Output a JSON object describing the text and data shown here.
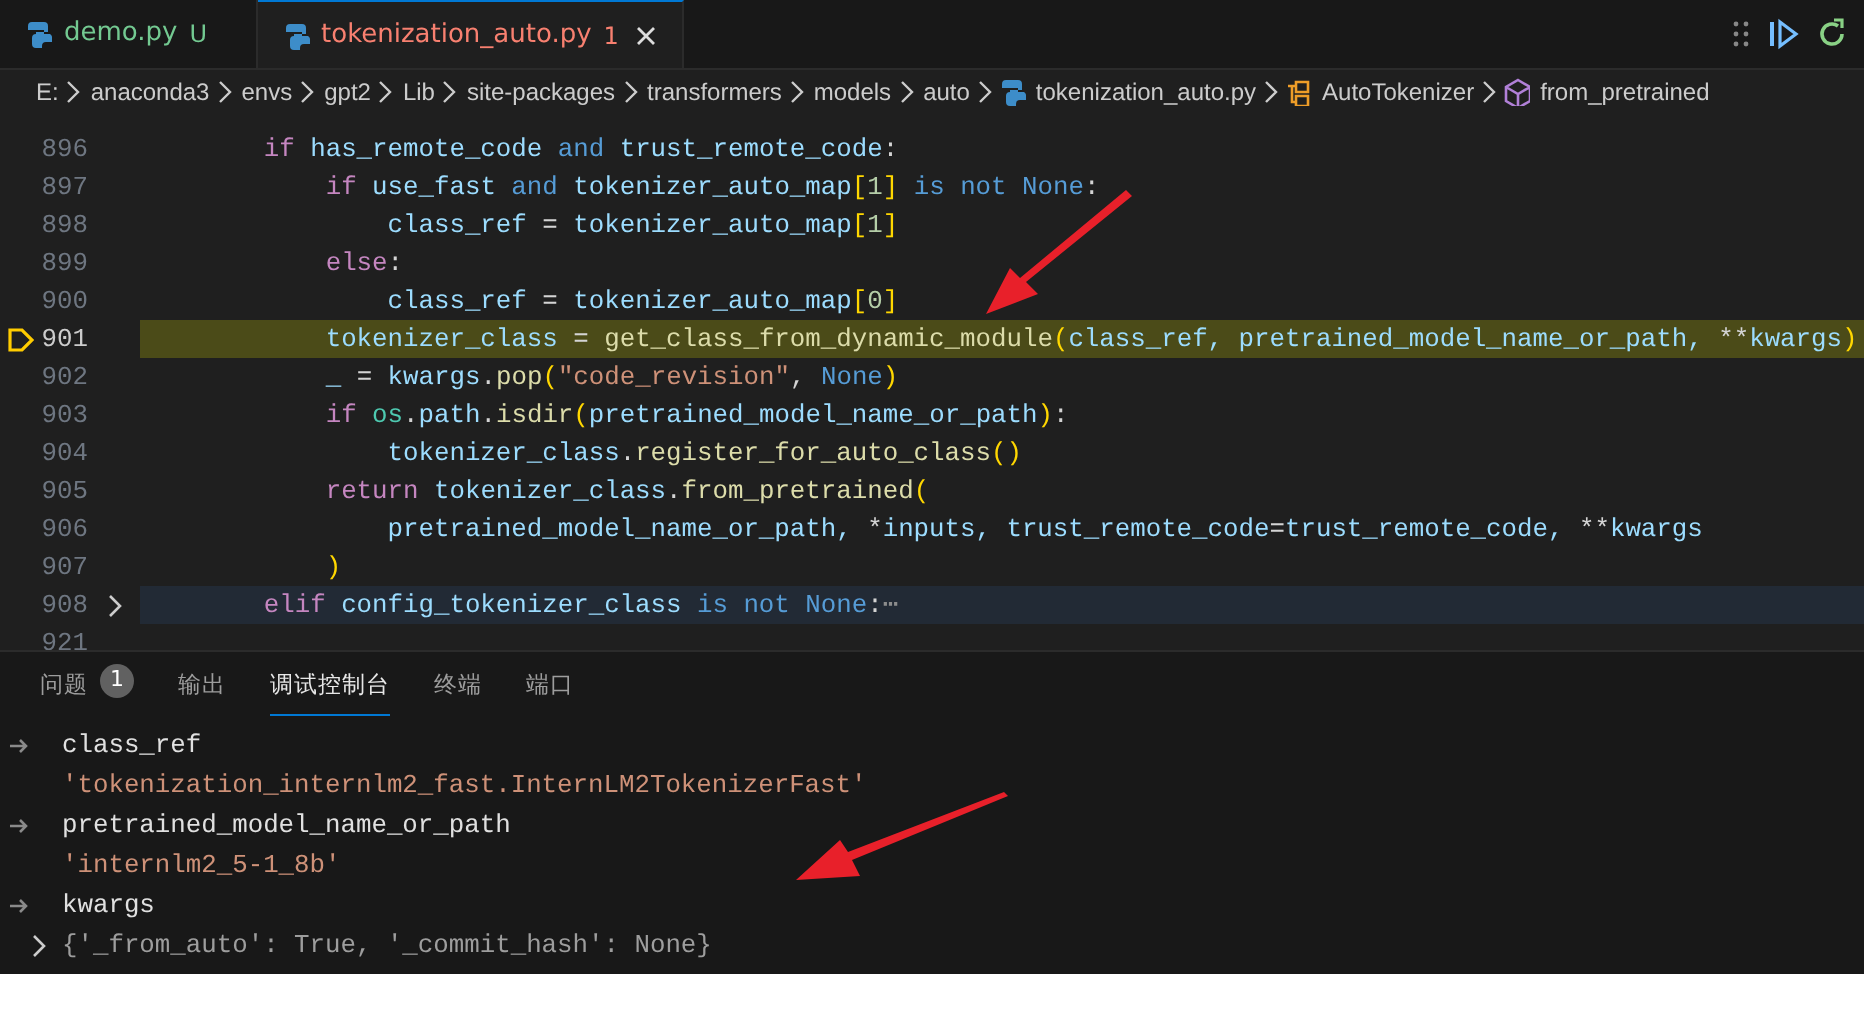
{
  "tabs": [
    {
      "label": "demo.py",
      "badge": "U",
      "color": "#73c991",
      "selected": false
    },
    {
      "label": "tokenization_auto.py",
      "badge": "1",
      "color": "#f88070",
      "selected": true
    }
  ],
  "breadcrumbs": [
    {
      "label": "E:",
      "kind": "folder"
    },
    {
      "label": "anaconda3",
      "kind": "folder"
    },
    {
      "label": "envs",
      "kind": "folder"
    },
    {
      "label": "gpt2",
      "kind": "folder"
    },
    {
      "label": "Lib",
      "kind": "folder"
    },
    {
      "label": "site-packages",
      "kind": "folder"
    },
    {
      "label": "transformers",
      "kind": "folder"
    },
    {
      "label": "models",
      "kind": "folder"
    },
    {
      "label": "auto",
      "kind": "folder"
    },
    {
      "label": "tokenization_auto.py",
      "kind": "file"
    },
    {
      "label": "AutoTokenizer",
      "kind": "class"
    },
    {
      "label": "from_pretrained",
      "kind": "method"
    }
  ],
  "code_lines": [
    {
      "number": "896",
      "current": false,
      "folded": false,
      "tokens": [
        {
          "t": "        if",
          "kind": "control"
        },
        {
          "t": " has_remote_code ",
          "kind": "var"
        },
        {
          "t": "and",
          "kind": "keyword"
        },
        {
          "t": " trust_remote_code",
          "kind": "var"
        },
        {
          "t": ":",
          "kind": "plain"
        }
      ]
    },
    {
      "number": "897",
      "current": false,
      "folded": false,
      "tokens": [
        {
          "t": "            if",
          "kind": "control"
        },
        {
          "t": " use_fast ",
          "kind": "var"
        },
        {
          "t": "and",
          "kind": "keyword"
        },
        {
          "t": " tokenizer_auto_map",
          "kind": "var"
        },
        {
          "t": "[",
          "kind": "bracket"
        },
        {
          "t": "1",
          "kind": "number"
        },
        {
          "t": "]",
          "kind": "bracket"
        },
        {
          "t": " is not None",
          "kind": "keyword"
        },
        {
          "t": ":",
          "kind": "plain"
        }
      ]
    },
    {
      "number": "898",
      "current": false,
      "folded": false,
      "tokens": [
        {
          "t": "                class_ref",
          "kind": "var"
        },
        {
          "t": " = ",
          "kind": "plain"
        },
        {
          "t": "tokenizer_auto_map",
          "kind": "var"
        },
        {
          "t": "[",
          "kind": "bracket"
        },
        {
          "t": "1",
          "kind": "number"
        },
        {
          "t": "]",
          "kind": "bracket"
        }
      ]
    },
    {
      "number": "899",
      "current": false,
      "folded": false,
      "tokens": [
        {
          "t": "            else",
          "kind": "control"
        },
        {
          "t": ":",
          "kind": "plain"
        }
      ]
    },
    {
      "number": "900",
      "current": false,
      "folded": false,
      "tokens": [
        {
          "t": "                class_ref",
          "kind": "var"
        },
        {
          "t": " = ",
          "kind": "plain"
        },
        {
          "t": "tokenizer_auto_map",
          "kind": "var"
        },
        {
          "t": "[",
          "kind": "bracket"
        },
        {
          "t": "0",
          "kind": "number"
        },
        {
          "t": "]",
          "kind": "bracket"
        }
      ]
    },
    {
      "number": "901",
      "current": true,
      "folded": false,
      "tokens": [
        {
          "t": "            tokenizer_class",
          "kind": "var"
        },
        {
          "t": " = ",
          "kind": "plain"
        },
        {
          "t": "get_class_from_dynamic_module",
          "kind": "function"
        },
        {
          "t": "(",
          "kind": "bracket"
        },
        {
          "t": "class_ref, pretrained_model_name_or_path, ",
          "kind": "var"
        },
        {
          "t": "**",
          "kind": "plain"
        },
        {
          "t": "kwargs",
          "kind": "var"
        },
        {
          "t": ")",
          "kind": "bracket"
        }
      ]
    },
    {
      "number": "902",
      "current": false,
      "folded": false,
      "tokens": [
        {
          "t": "            _",
          "kind": "var"
        },
        {
          "t": " = ",
          "kind": "plain"
        },
        {
          "t": "kwargs",
          "kind": "var"
        },
        {
          "t": ".",
          "kind": "plain"
        },
        {
          "t": "pop",
          "kind": "function"
        },
        {
          "t": "(",
          "kind": "bracket"
        },
        {
          "t": "\"code_revision\"",
          "kind": "string"
        },
        {
          "t": ", ",
          "kind": "plain"
        },
        {
          "t": "None",
          "kind": "keyword"
        },
        {
          "t": ")",
          "kind": "bracket"
        }
      ]
    },
    {
      "number": "903",
      "current": false,
      "folded": false,
      "tokens": [
        {
          "t": "            if",
          "kind": "control"
        },
        {
          "t": " os",
          "kind": "module"
        },
        {
          "t": ".",
          "kind": "plain"
        },
        {
          "t": "path",
          "kind": "var"
        },
        {
          "t": ".",
          "kind": "plain"
        },
        {
          "t": "isdir",
          "kind": "function"
        },
        {
          "t": "(",
          "kind": "bracket"
        },
        {
          "t": "pretrained_model_name_or_path",
          "kind": "var"
        },
        {
          "t": ")",
          "kind": "bracket"
        },
        {
          "t": ":",
          "kind": "plain"
        }
      ]
    },
    {
      "number": "904",
      "current": false,
      "folded": false,
      "tokens": [
        {
          "t": "                tokenizer_class",
          "kind": "var"
        },
        {
          "t": ".",
          "kind": "plain"
        },
        {
          "t": "register_for_auto_class",
          "kind": "function"
        },
        {
          "t": "()",
          "kind": "bracket"
        }
      ]
    },
    {
      "number": "905",
      "current": false,
      "folded": false,
      "tokens": [
        {
          "t": "            return",
          "kind": "control"
        },
        {
          "t": " tokenizer_class",
          "kind": "var"
        },
        {
          "t": ".",
          "kind": "plain"
        },
        {
          "t": "from_pretrained",
          "kind": "function"
        },
        {
          "t": "(",
          "kind": "bracket"
        }
      ]
    },
    {
      "number": "906",
      "current": false,
      "folded": false,
      "tokens": [
        {
          "t": "                pretrained_model_name_or_path, ",
          "kind": "var"
        },
        {
          "t": "*",
          "kind": "plain"
        },
        {
          "t": "inputs, trust_remote_code",
          "kind": "var"
        },
        {
          "t": "=",
          "kind": "plain"
        },
        {
          "t": "trust_remote_code, ",
          "kind": "var"
        },
        {
          "t": "**",
          "kind": "plain"
        },
        {
          "t": "kwargs",
          "kind": "var"
        }
      ]
    },
    {
      "number": "907",
      "current": false,
      "folded": false,
      "tokens": [
        {
          "t": "            )",
          "kind": "bracket"
        }
      ]
    },
    {
      "number": "908",
      "current": false,
      "folded": true,
      "tokens": [
        {
          "t": "        elif",
          "kind": "control"
        },
        {
          "t": " config_tokenizer_class ",
          "kind": "var"
        },
        {
          "t": "is not None",
          "kind": "keyword"
        },
        {
          "t": ":",
          "kind": "plain"
        },
        {
          "t": "⋯",
          "kind": "ellipsis"
        }
      ]
    },
    {
      "number": "921",
      "current": false,
      "folded": false
    }
  ],
  "panel_tabs": [
    {
      "label": "问题",
      "badge": "1",
      "selected": false
    },
    {
      "label": "输出",
      "selected": false
    },
    {
      "label": "调试控制台",
      "selected": true
    },
    {
      "label": "终端",
      "selected": false
    },
    {
      "label": "端口",
      "selected": false
    }
  ],
  "console": [
    {
      "kind": "input",
      "text": "class_ref"
    },
    {
      "kind": "string",
      "text": "'tokenization_internlm2_fast.InternLM2TokenizerFast'"
    },
    {
      "kind": "input",
      "text": "pretrained_model_name_or_path"
    },
    {
      "kind": "string",
      "text": "'internlm2_5-1_8b'"
    },
    {
      "kind": "input",
      "text": "kwargs"
    },
    {
      "kind": "object",
      "text": "{'_from_auto': True, '_commit_hash': None}",
      "expanded": false
    }
  ]
}
